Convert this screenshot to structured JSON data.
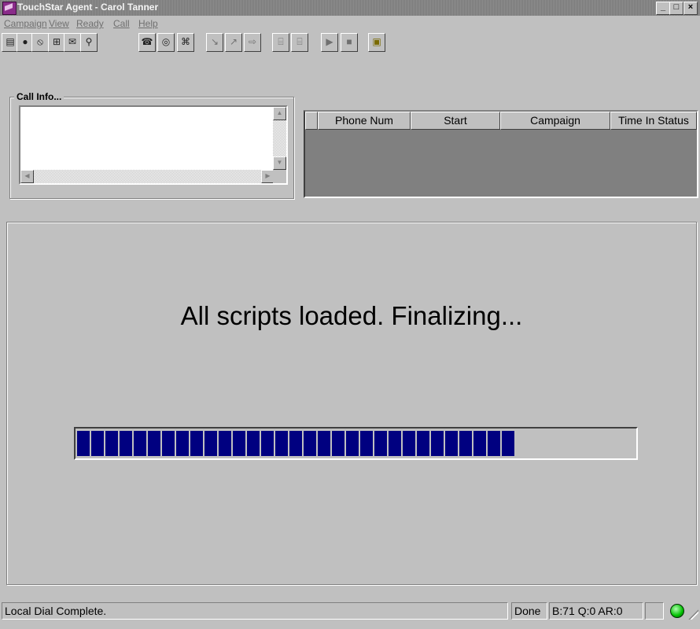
{
  "window": {
    "title": "TouchStar Agent - Carol Tanner",
    "buttons": [
      "_",
      "□",
      "×"
    ]
  },
  "menu": [
    "Campaign",
    "View",
    "Ready",
    "Call",
    "Help"
  ],
  "toolbar": {
    "icons": [
      "notes-icon",
      "record-icon",
      "no-icon",
      "directory-icon",
      "mail-icon",
      "schedule-icon",
      "phone-icon",
      "dial-icon",
      "hangup-icon",
      "transfer-icon",
      "conference-icon",
      "forward-icon",
      "hold-icon",
      "release-icon",
      "play-icon",
      "stop-icon",
      "disk-icon"
    ],
    "glyphs": [
      "▤",
      "●",
      "⦸",
      "⊞",
      "✉",
      "⚲",
      "☎",
      "◎",
      "⌘",
      "↘",
      "↗",
      "⇨",
      "⌸",
      "⌸",
      "▶",
      "■",
      "▣"
    ]
  },
  "call_info": {
    "label": "Call Info...",
    "text": ""
  },
  "call_list": {
    "columns": [
      "",
      "Phone Num",
      "Start",
      "Campaign",
      "Time In Status"
    ],
    "rows": []
  },
  "main": {
    "message": "All scripts loaded. Finalizing...",
    "progress": 0.8
  },
  "status": {
    "message": "Local Dial Complete.",
    "state": "Done",
    "counts": "B:71 Q:0 AR:0",
    "indicator_color": "#00c000"
  }
}
